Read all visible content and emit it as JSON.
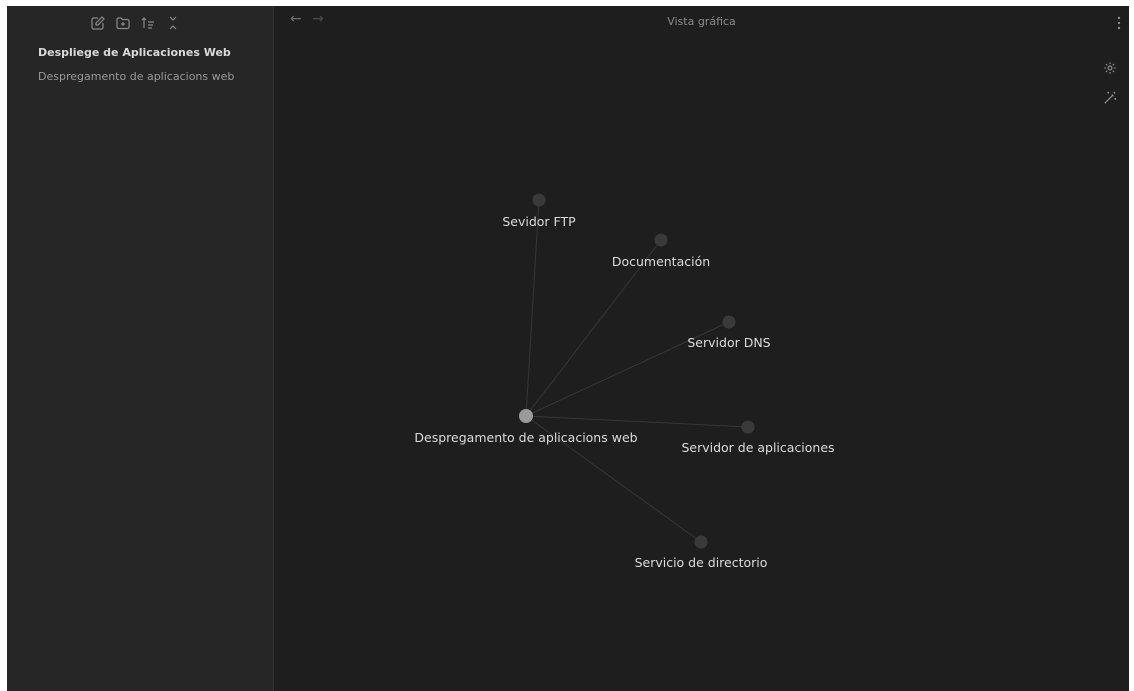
{
  "sidebar": {
    "toolbar": {
      "new_note_icon": "new-note-icon",
      "new_folder_icon": "new-folder-icon",
      "sort_icon": "sort-icon",
      "collapse_icon": "collapse-all-icon"
    },
    "vault_title": "Despliege de Aplicaciones Web",
    "files": [
      {
        "label": "Despregamento de aplicacions web"
      }
    ]
  },
  "header": {
    "back_icon": "arrow-left-icon",
    "forward_icon": "arrow-right-icon",
    "title": "Vista gráfica",
    "more_icon": "more-vertical-icon"
  },
  "graph_controls": {
    "settings_icon": "gear-icon",
    "animate_icon": "magic-wand-icon"
  },
  "graph": {
    "center": "Despregamento de aplicacions web",
    "nodes": [
      {
        "label": "Sevidor FTP"
      },
      {
        "label": "Documentación"
      },
      {
        "label": "Servidor DNS"
      },
      {
        "label": "Servidor de aplicaciones"
      },
      {
        "label": "Servicio de directorio"
      }
    ]
  },
  "colors": {
    "background": "#1e1e1e",
    "sidebar": "#262626",
    "node": "#3a3a3a",
    "center_node": "#9a9a9a",
    "edge": "#363636",
    "label": "#dcdcdc"
  }
}
